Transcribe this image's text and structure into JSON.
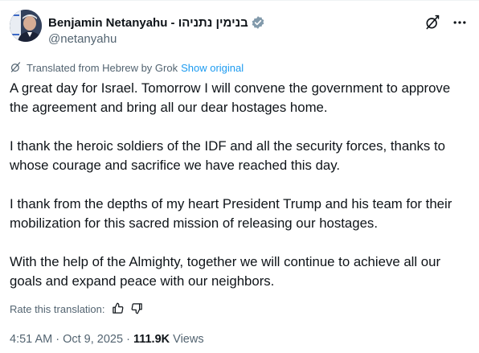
{
  "author": {
    "display_name": "Benjamin Netanyahu - בנימין נתניהו",
    "handle": "@netanyahu",
    "verified_icon": "verified-badge-icon"
  },
  "translation": {
    "label": "Translated from Hebrew by Grok",
    "show_original": "Show original"
  },
  "post": {
    "paragraphs": [
      "A great day for Israel. Tomorrow I will convene the government to approve the agreement and bring all our dear hostages home.",
      "I thank the heroic soldiers of the IDF and all the security forces, thanks to whose courage and sacrifice we have reached this day.",
      "I thank from the depths of my heart President Trump and his team for their mobilization for this sacred mission of releasing our hostages.",
      "With the help of the Almighty, together we will continue to achieve all our goals and expand peace with our neighbors."
    ]
  },
  "rate": {
    "label": "Rate this translation:"
  },
  "meta": {
    "time": "4:51 AM",
    "separator": " · ",
    "date": "Oct 9, 2025",
    "views_count": "111.9K",
    "views_label": "Views"
  },
  "colors": {
    "text": "#0f1419",
    "secondary": "#536471",
    "link": "#1d9bf0",
    "verified": "#829aab"
  }
}
